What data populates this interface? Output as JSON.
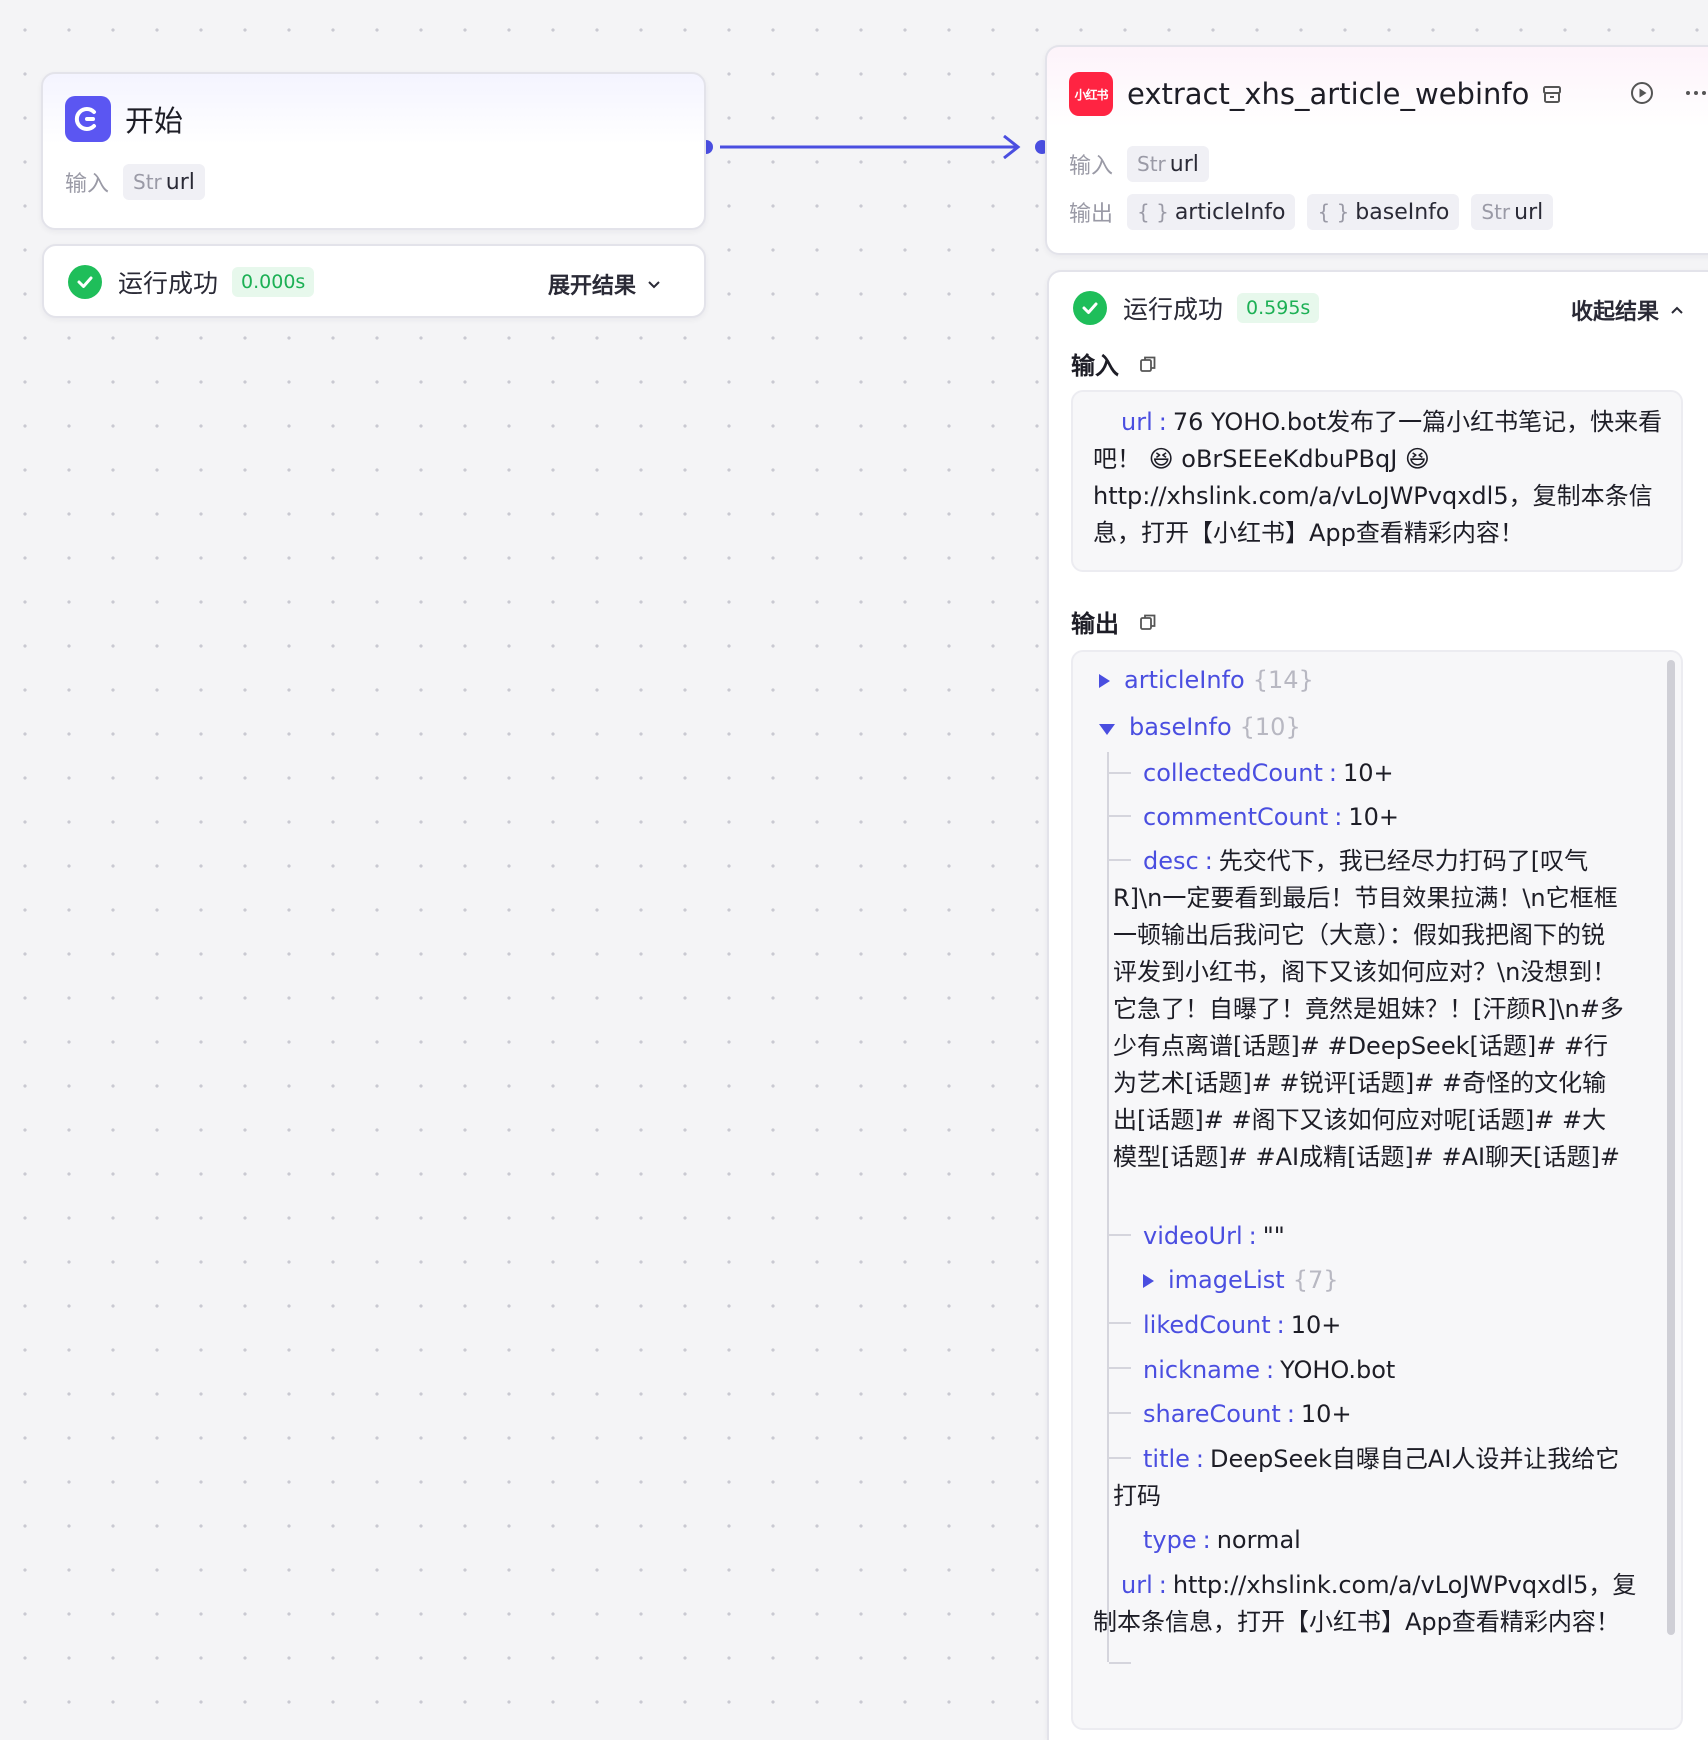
{
  "start_node": {
    "title": "开始",
    "input_label": "输入",
    "input_tag": {
      "type": "Str",
      "name": "url"
    }
  },
  "start_result": {
    "status": "运行成功",
    "time": "0.000s",
    "toggle": "展开结果"
  },
  "xhs_node": {
    "logo_text": "小红书",
    "title": "extract_xhs_article_webinfo",
    "input_label": "输入",
    "input_tag": {
      "type": "Str",
      "name": "url"
    },
    "output_label": "输出",
    "output_tags": [
      {
        "type": "{ }",
        "name": "articleInfo"
      },
      {
        "type": "{ }",
        "name": "baseInfo"
      },
      {
        "type": "Str",
        "name": "url"
      }
    ]
  },
  "xhs_result": {
    "status": "运行成功",
    "time": "0.595s",
    "toggle": "收起结果",
    "input_section": "输入",
    "output_section": "输出",
    "input_key": "url",
    "input_value": "76 YOHO.bot发布了一篇小红书笔记，快来看吧！ 😆 oBrSEEeKdbuPBqJ 😆 http://xhslink.com/a/vLoJWPvqxdl5，复制本条信息，打开【小红书】App查看精彩内容！",
    "output": {
      "articleInfo": {
        "key": "articleInfo",
        "count": "{14}"
      },
      "baseInfo": {
        "key": "baseInfo",
        "count": "{10}"
      },
      "collectedCount": {
        "key": "collectedCount",
        "value": "10+"
      },
      "commentCount": {
        "key": "commentCount",
        "value": "10+"
      },
      "desc": {
        "key": "desc",
        "value": "先交代下，我已经尽力打码了[叹气R]\\n一定要看到最后！节目效果拉满！\\n它框框一顿输出后我问它（大意）：假如我把阁下的锐评发到小红书，阁下又该如何应对？\\n没想到！它急了！自曝了！竟然是姐妹？！[汗颜R]\\n#多少有点离谱[话题]# #DeepSeek[话题]# #行为艺术[话题]# #锐评[话题]# #奇怪的文化输出[话题]# #阁下又该如何应对呢[话题]# #大模型[话题]# #AI成精[话题]# #AI聊天[话题]#"
      },
      "videoUrl": {
        "key": "videoUrl",
        "value": "\"\""
      },
      "imageList": {
        "key": "imageList",
        "count": "{7}"
      },
      "likedCount": {
        "key": "likedCount",
        "value": "10+"
      },
      "nickname": {
        "key": "nickname",
        "value": "YOHO.bot"
      },
      "shareCount": {
        "key": "shareCount",
        "value": "10+"
      },
      "title": {
        "key": "title",
        "value": "DeepSeek自曝自己AI人设并让我给它打码"
      },
      "type": {
        "key": "type",
        "value": "normal"
      },
      "url": {
        "key": "url",
        "value": "http://xhslink.com/a/vLoJWPvqxdl5，复制本条信息，打开【小红书】App查看精彩内容！"
      }
    }
  },
  "colors": {
    "accent": "#5b56f2",
    "success": "#1fbe5a",
    "key": "#4a4ee0",
    "xhs_red": "#ff2442"
  }
}
